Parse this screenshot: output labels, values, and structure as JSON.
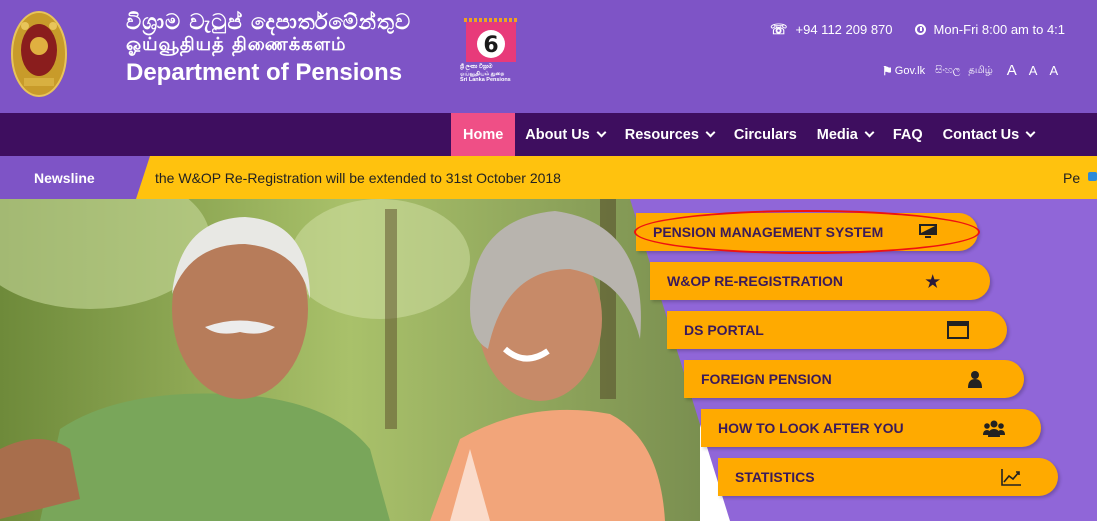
{
  "header": {
    "department_sinhala": "විශ්‍රාම වැටුප් දෙපාර්තමේන්තුව",
    "department_tamil": "ஓய்வூதியத் திணைக்களம்",
    "department_english": "Department of  Pensions",
    "logo_caption": [
      "ශ්‍රී ලංකා විශ්‍රාම",
      "ஓய்வூதியம் துறை",
      "Sri Lanka Pensions"
    ],
    "phone": "+94 112 209 870",
    "hours": "Mon-Fri 8:00 am to 4:1",
    "govlk": "Gov.lk",
    "lang_sinhala": "සිංහල",
    "lang_tamil": "தமிழ்",
    "font_size_large": "A",
    "font_size_medium": "A",
    "font_size_small": "A"
  },
  "nav": {
    "items": [
      {
        "label": "Home",
        "active": true
      },
      {
        "label": "About Us",
        "dropdown": true
      },
      {
        "label": "Resources",
        "dropdown": true
      },
      {
        "label": "Circulars",
        "dropdown": false
      },
      {
        "label": "Media",
        "dropdown": true
      },
      {
        "label": "FAQ",
        "dropdown": false
      },
      {
        "label": "Contact Us",
        "dropdown": true
      }
    ]
  },
  "newsline": {
    "label": "Newsline",
    "text": "the W&OP Re-Registration will be extended to 31st October 2018",
    "text_tail": "Pe"
  },
  "quick_links": [
    {
      "label": "PENSION MANAGEMENT SYSTEM",
      "icon": "monitor-icon",
      "highlighted": true
    },
    {
      "label": "W&OP RE-REGISTRATION",
      "icon": "star-plus-icon"
    },
    {
      "label": "DS PORTAL",
      "icon": "window-icon"
    },
    {
      "label": "FOREIGN PENSION",
      "icon": "user-icon"
    },
    {
      "label": "HOW TO LOOK AFTER YOU",
      "icon": "users-icon"
    },
    {
      "label": "STATISTICS",
      "icon": "chart-line-icon"
    }
  ],
  "colors": {
    "header_purple": "#7e54c6",
    "nav_dark": "#3e0e5f",
    "nav_active": "#ef4f86",
    "news_yellow": "#ffc20e",
    "button_orange": "#ffaa00",
    "highlight_red": "#ee1111"
  }
}
